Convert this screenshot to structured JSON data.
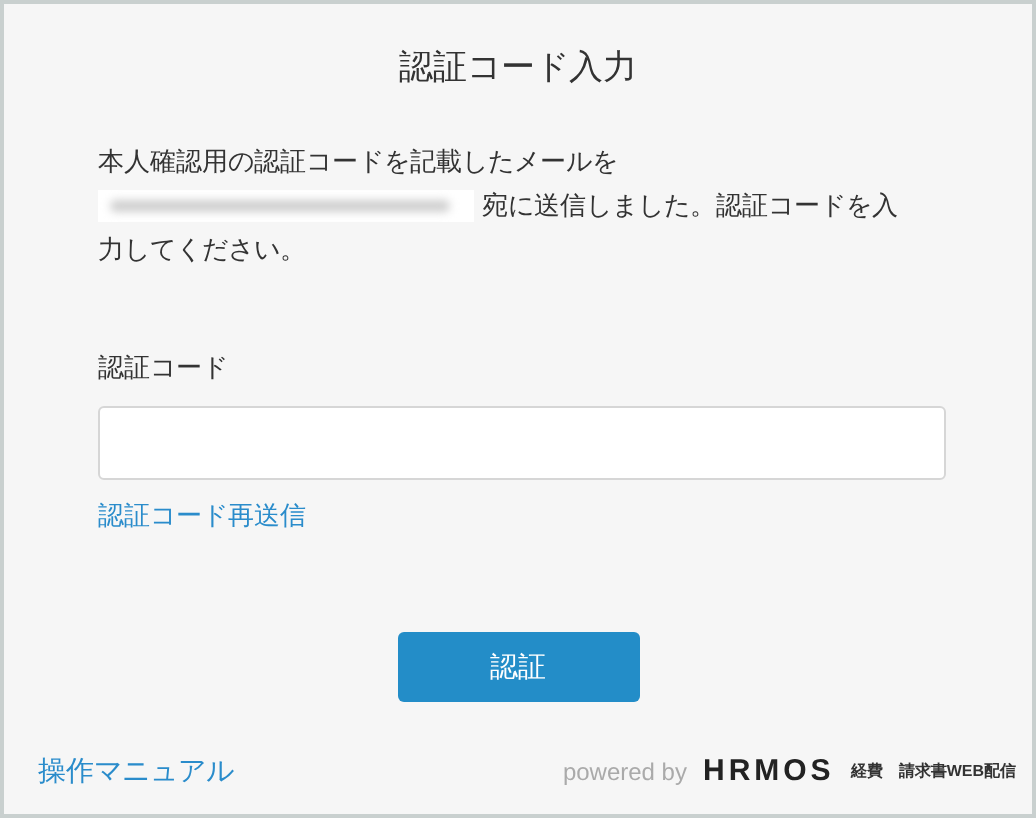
{
  "title": "認証コード入力",
  "message": {
    "line_1": "本人確認用の認証コードを記載したメールを",
    "email_blurred": true,
    "line_2": "宛に送信しました。認証コードを入",
    "line_3": "力してください。"
  },
  "code_field": {
    "label": "認証コード"
  },
  "resend_link": "認証コード再送信",
  "submit_button": "認証",
  "footer": {
    "manual_link": "操作マニュアル",
    "powered_by": "powered by",
    "brand": "HRMOS",
    "product_1": "経費",
    "product_2": "請求書WEB配信"
  }
}
